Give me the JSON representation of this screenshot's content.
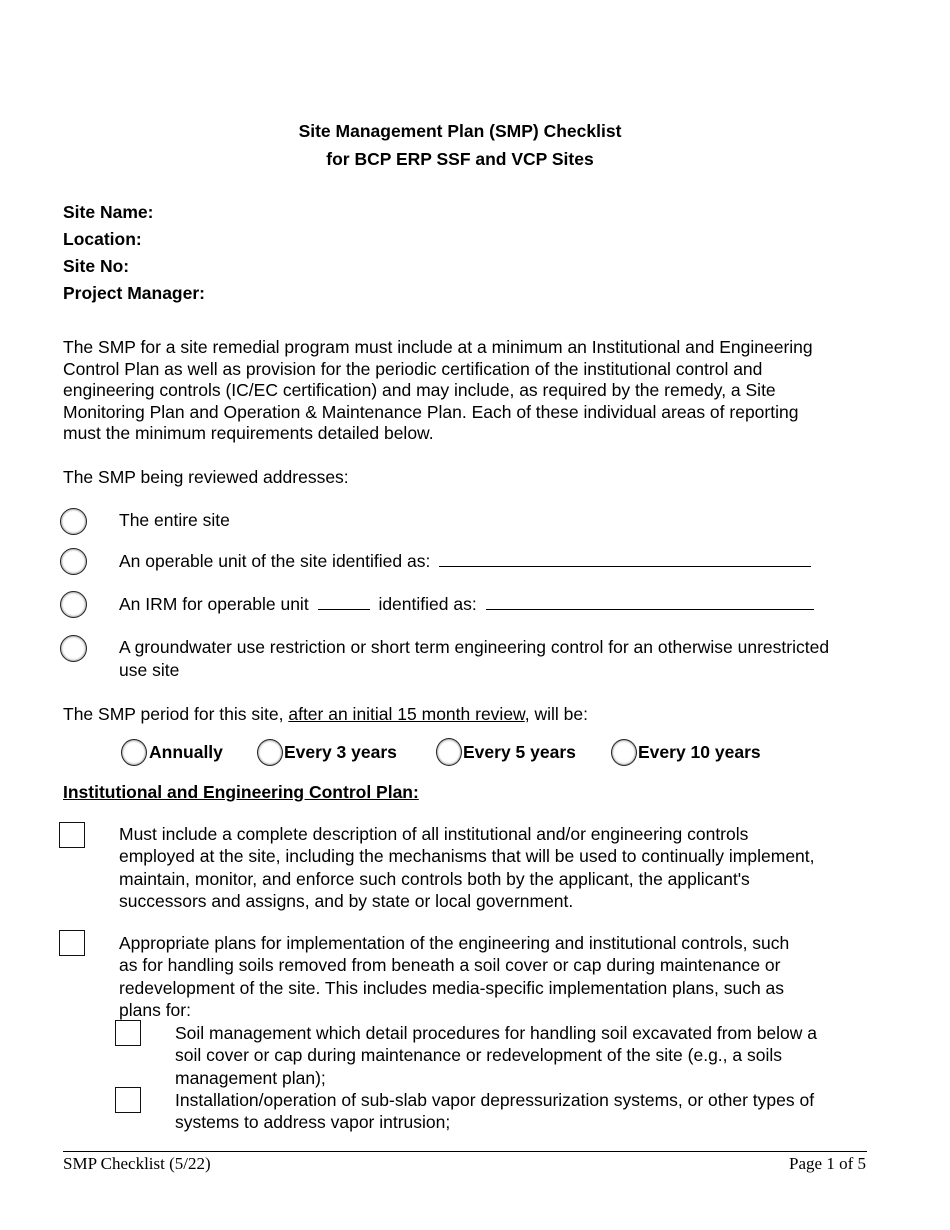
{
  "header": {
    "title_line1": "Site Management Plan (SMP) Checklist",
    "title_line2": "for BCP ERP SSF and VCP Sites"
  },
  "fields": [
    {
      "label": "Site Name:",
      "value": ""
    },
    {
      "label": "Location:",
      "value": ""
    },
    {
      "label": "Site No:",
      "value": ""
    },
    {
      "label": "Project Manager:",
      "value": ""
    }
  ],
  "intro": {
    "lines": [
      "The SMP for a site remedial program must include at a minimum an Institutional and Engineering",
      "Control Plan as well as provision for the periodic certification of the institutional control and",
      "engineering controls (IC/EC certification) and may include, as required by the remedy, a Site",
      "Monitoring Plan and Operation & Maintenance Plan.  Each of these individual areas of reporting",
      "must the minimum requirements detailed below."
    ]
  },
  "scope": {
    "prompt": "The SMP being reviewed addresses:",
    "options": [
      {
        "label": "The entire site",
        "selected": false
      },
      {
        "label": "An operable unit of the site identified as:",
        "value": "",
        "selected": false
      },
      {
        "label_before": "An IRM for operable unit",
        "unit_value": "",
        "label_after": "identified as:",
        "value": "",
        "selected": false
      },
      {
        "label_line1": "A groundwater use restriction or short term engineering control for an otherwise unrestricted",
        "label_line2": "use site",
        "selected": false
      }
    ]
  },
  "period": {
    "prompt_before": "The SMP period for this site,",
    "prompt_underlined": "after an initial 15 month review",
    "prompt_after": ", will be:",
    "options": [
      {
        "label": "Annually",
        "selected": false
      },
      {
        "label": "Every 3 years",
        "selected": false
      },
      {
        "label": "Every 5 years",
        "selected": false
      },
      {
        "label": "Every 10 years",
        "selected": false
      }
    ]
  },
  "iec_section": {
    "heading": "Institutional and Engineering Control Plan:",
    "items": [
      {
        "checked": false,
        "lines": [
          "Must include a complete description of all institutional and/or engineering controls",
          "employed at the site, including the mechanisms that will be used to continually implement,",
          "maintain, monitor, and enforce such controls both by the applicant, the applicant's",
          "successors and assigns, and by state or local government."
        ]
      },
      {
        "checked": false,
        "lines": [
          "Appropriate plans for implementation of the engineering and institutional controls, such",
          "as for handling soils removed from beneath a soil cover or cap during maintenance or",
          "redevelopment of the site.  This includes media-specific implementation plans, such as",
          "plans for:"
        ],
        "subitems": [
          {
            "checked": false,
            "lines": [
              "Soil management which detail procedures for handling soil excavated from below a",
              "soil cover or cap during maintenance or redevelopment of the site (e.g., a soils",
              "management plan);"
            ]
          },
          {
            "checked": false,
            "lines": [
              "Installation/operation of sub-slab vapor depressurization systems, or other types of",
              "systems to address vapor intrusion;"
            ]
          }
        ]
      }
    ]
  },
  "footer": {
    "left": "SMP Checklist (5/22)",
    "right": "Page 1 of 5"
  }
}
